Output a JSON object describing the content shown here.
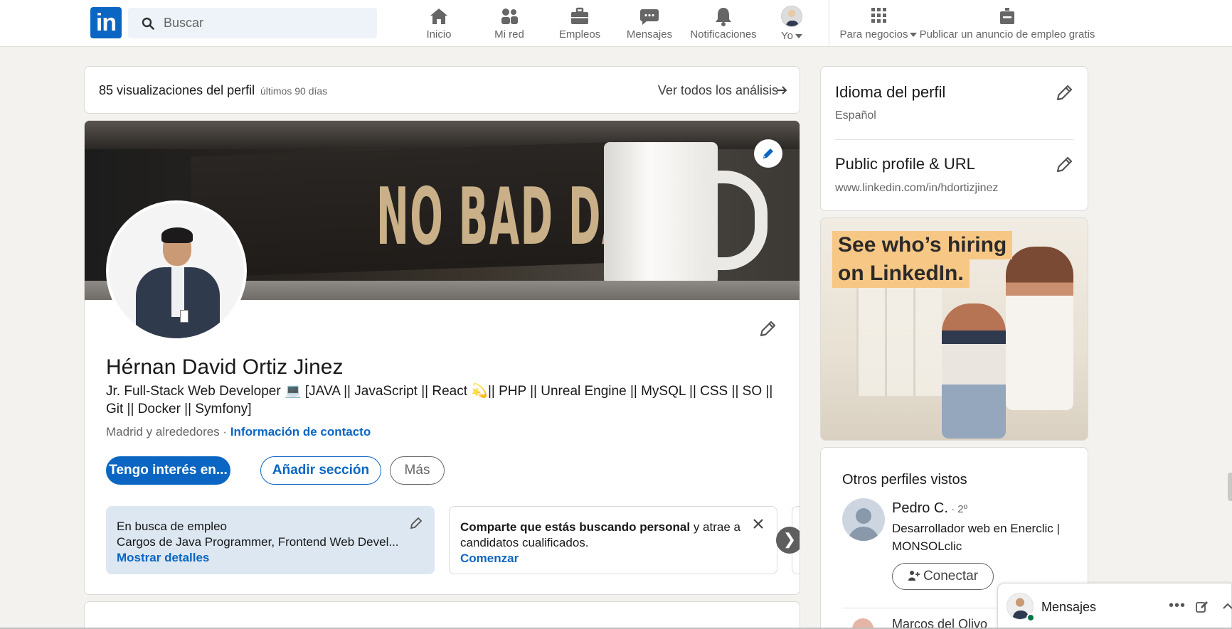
{
  "header": {
    "logo_text": "in",
    "search_placeholder": "Buscar",
    "nav": [
      {
        "label": "Inicio",
        "icon": "home-icon"
      },
      {
        "label": "Mi red",
        "icon": "network-icon"
      },
      {
        "label": "Empleos",
        "icon": "briefcase-icon"
      },
      {
        "label": "Mensajes",
        "icon": "chat-icon"
      },
      {
        "label": "Notificaciones",
        "icon": "bell-icon"
      },
      {
        "label": "Yo",
        "icon": "avatar"
      }
    ],
    "business_label": "Para negocios",
    "post_job_label": "Publicar un anuncio de empleo gratis"
  },
  "analytics": {
    "views_label": "85 visualizaciones del perfil",
    "period": "últimos 90 días",
    "see_all": "Ver todos los análisis"
  },
  "profile": {
    "banner_text": "NO BAD DAYS",
    "name": "Hérnan David Ortiz Jinez",
    "headline": "Jr. Full-Stack Web Developer 💻 [JAVA || JavaScript || React 💫|| PHP || Unreal Engine || MySQL || CSS || SO || Git || Docker || Symfony]",
    "location": "Madrid y alrededores · ",
    "contact_link": "Información de contacto",
    "buttons": {
      "interest": "Tengo interés en...",
      "add_section": "Añadir sección",
      "more": "Más"
    },
    "open_to_work": {
      "title": "En busca de empleo",
      "detail": "Cargos de Java Programmer, Frontend Web Devel...",
      "link": "Mostrar detalles"
    },
    "hiring": {
      "title_bold": "Comparte que estás buscando personal",
      "title_rest": " y atrae a",
      "line2": "candidatos cualificados.",
      "link": "Comenzar"
    }
  },
  "sidebar": {
    "language": {
      "title": "Idioma del perfil",
      "value": "Español"
    },
    "public_profile": {
      "title": "Public profile & URL",
      "value": "www.linkedin.com/in/hdortizjinez"
    },
    "ad": {
      "line1": "See who’s hiring",
      "line2": "on LinkedIn."
    },
    "others": {
      "title": "Otros perfiles vistos",
      "person": {
        "name": "Pedro C.",
        "degree": " · 2º",
        "description": "Desarrollador web en Enerclic | MONSOLclic",
        "connect": "Conectar"
      },
      "next_person": "Marcos del Olivo"
    }
  },
  "messaging": {
    "label": "Mensajes"
  },
  "colors": {
    "brand": "#0a66c2",
    "background": "#f4f2ee",
    "online": "#057642"
  }
}
